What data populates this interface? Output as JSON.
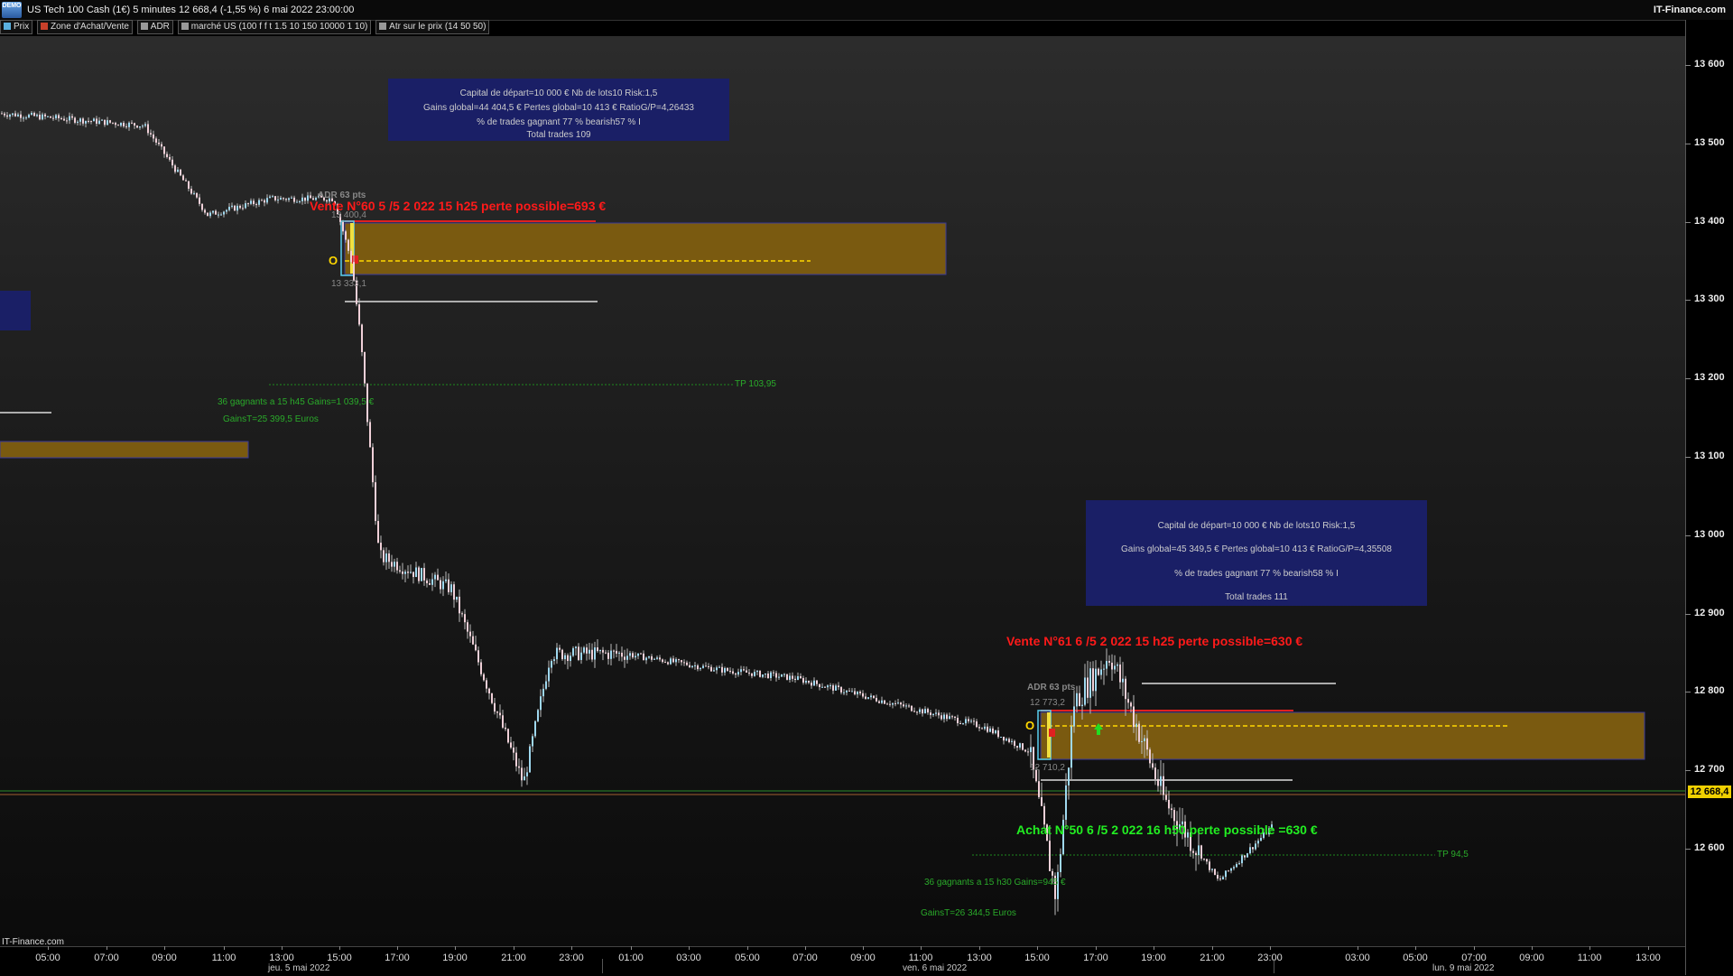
{
  "titlebar": {
    "logo_text": "DEMO",
    "title": "US Tech 100 Cash (1€) 5 minutes 12 668,4 (-1,55 %) 6 mai 2022 23:00:00",
    "brand": "IT-Finance.com"
  },
  "legend": [
    {
      "label": "Prix",
      "color": "#5ab0e0"
    },
    {
      "label": "Zone d'Achat/Vente",
      "color": "#c8402a"
    },
    {
      "label": "ADR",
      "color": "#999999"
    },
    {
      "label": "marché US (100 f f t 1.5 10 150 10000 1 10)",
      "color": "#999999"
    },
    {
      "label": "Atr sur le prix (14 50 50)",
      "color": "#999999"
    }
  ],
  "y_axis": [
    "13 600",
    "13 500",
    "13 400",
    "13 300",
    "13 200",
    "13 100",
    "13 000",
    "12 900",
    "12 800",
    "12 700",
    "12 600"
  ],
  "price_tag": "12 668,4",
  "x_axis": [
    "05:00",
    "07:00",
    "09:00",
    "11:00",
    "13:00",
    "15:00",
    "17:00",
    "19:00",
    "21:00",
    "23:00",
    "01:00",
    "03:00",
    "05:00",
    "07:00",
    "09:00",
    "11:00",
    "13:00",
    "15:00",
    "17:00",
    "19:00",
    "21:00",
    "23:00",
    "03:00",
    "05:00",
    "07:00",
    "09:00",
    "11:00",
    "13:00"
  ],
  "dates": [
    "jeu. 5 mai 2022",
    "ven. 6 mai 2022",
    "lun. 9 mai 2022"
  ],
  "footer": "IT-Finance.com",
  "info_box_1": {
    "line1": "Capital de départ=10 000 € Nb de lots10  Risk:1,5",
    "line2": "Gains global=44 404,5 € Pertes global=10 413 € RatioG/P=4,26433",
    "line3": "% de trades gagnant 77 % bearish57 % I",
    "line4": "Total trades 109"
  },
  "info_box_2": {
    "line1": "Capital de départ=10 000 € Nb de lots10  Risk:1,5",
    "line2": "Gains global=45 349,5 € Pertes global=10 413 € RatioG/P=4,35508",
    "line3": "% de trades gagnant 77 % bearish58 % I",
    "line4": "Total trades 111"
  },
  "trade1": {
    "title": "Vente N°60  5 /5  2 022  15 h25  perte possible=693 €",
    "adr": "ADR 63 pts",
    "top_price": "13 400,4",
    "bottom_price": "13 333,1",
    "marker": "O",
    "tp": "TP 103,95",
    "winners": "36  gagnants a 15 h45  Gains=1 039,5 €",
    "total": "GainsT=25 399,5 Euros"
  },
  "trade2": {
    "title": "Vente N°61  6 /5  2 022  15 h25  perte possible=630 €",
    "adr": "ADR 63 pts",
    "top_price": "12 773,2",
    "bottom_price": "12 710,2",
    "marker": "O",
    "buy_title": "Achat N°50 6 /5  2 022  16 h50 perte possible =630 €",
    "tp": "TP 94,5",
    "winners": "36  gagnants a 15 h30  Gains=945 €",
    "total": "GainsT=26 344,5 Euros"
  },
  "chart_data": {
    "type": "candlestick",
    "title": "US Tech 100 Cash (1€) 5 minutes",
    "ylim": [
      12520,
      13640
    ],
    "x": [
      "jeu. 5 mai 2022 05:00",
      "jeu. 5 mai 2022 09:00",
      "jeu. 5 mai 2022 11:00",
      "jeu. 5 mai 2022 13:00",
      "jeu. 5 mai 2022 15:00",
      "jeu. 5 mai 2022 15:25",
      "jeu. 5 mai 2022 16:00",
      "jeu. 5 mai 2022 17:00",
      "jeu. 5 mai 2022 19:00",
      "jeu. 5 mai 2022 21:00",
      "jeu. 5 mai 2022 23:00",
      "ven. 6 mai 2022 01:00",
      "ven. 6 mai 2022 05:00",
      "ven. 6 mai 2022 09:00",
      "ven. 6 mai 2022 13:00",
      "ven. 6 mai 2022 15:00",
      "ven. 6 mai 2022 15:30",
      "ven. 6 mai 2022 16:00",
      "ven. 6 mai 2022 17:00",
      "ven. 6 mai 2022 19:00",
      "ven. 6 mai 2022 21:00",
      "ven. 6 mai 2022 23:00"
    ],
    "close": [
      13545,
      13530,
      13420,
      13440,
      13440,
      13360,
      13260,
      13000,
      12960,
      12720,
      12880,
      12880,
      12860,
      12850,
      12790,
      12760,
      12580,
      12820,
      12880,
      12700,
      12600,
      12668
    ]
  }
}
